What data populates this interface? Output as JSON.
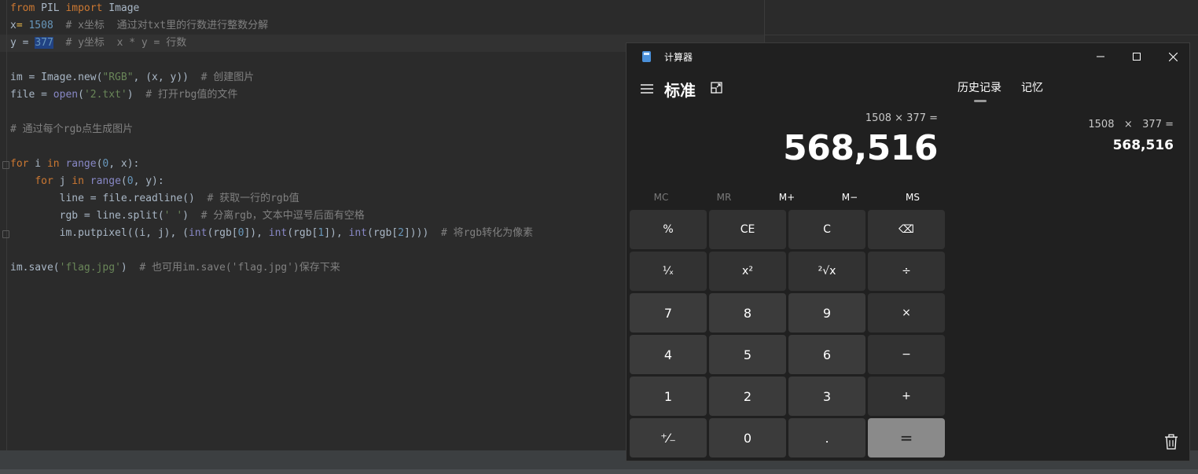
{
  "editor": {
    "lines": [
      [
        {
          "t": "from",
          "c": "kw"
        },
        {
          "t": " PIL "
        },
        {
          "t": "import",
          "c": "kw"
        },
        {
          "t": " Image"
        }
      ],
      [
        {
          "t": "x"
        },
        {
          "t": "= ",
          "c": "bulb"
        },
        {
          "t": "1508",
          "c": "num"
        },
        {
          "t": "  "
        },
        {
          "t": "# x坐标  通过对txt里的行数进行整数分解",
          "c": "cmt"
        }
      ],
      [
        {
          "t": "y = "
        },
        {
          "t": "377",
          "c": "num sel"
        },
        {
          "t": "  "
        },
        {
          "t": "# y坐标  x * y = 行数",
          "c": "cmt"
        }
      ],
      [],
      [
        {
          "t": "im = Image.new("
        },
        {
          "t": "\"RGB\"",
          "c": "str"
        },
        {
          "t": ", (x, y))  "
        },
        {
          "t": "# 创建图片",
          "c": "cmt"
        }
      ],
      [
        {
          "t": "file = "
        },
        {
          "t": "open",
          "c": "bi"
        },
        {
          "t": "("
        },
        {
          "t": "'2.txt'",
          "c": "str"
        },
        {
          "t": ")  "
        },
        {
          "t": "# 打开rbg值的文件",
          "c": "cmt"
        }
      ],
      [],
      [
        {
          "t": "# 通过每个rgb点生成图片",
          "c": "cmt"
        }
      ],
      [],
      [
        {
          "t": "for",
          "c": "kw"
        },
        {
          "t": " i "
        },
        {
          "t": "in",
          "c": "kw"
        },
        {
          "t": " "
        },
        {
          "t": "range",
          "c": "bi"
        },
        {
          "t": "("
        },
        {
          "t": "0",
          "c": "num"
        },
        {
          "t": ", x):"
        }
      ],
      [
        {
          "t": "    "
        },
        {
          "t": "for",
          "c": "kw"
        },
        {
          "t": " j "
        },
        {
          "t": "in",
          "c": "kw"
        },
        {
          "t": " "
        },
        {
          "t": "range",
          "c": "bi"
        },
        {
          "t": "("
        },
        {
          "t": "0",
          "c": "num"
        },
        {
          "t": ", y):"
        }
      ],
      [
        {
          "t": "        line = file.readline()  "
        },
        {
          "t": "# 获取一行的rgb值",
          "c": "cmt"
        }
      ],
      [
        {
          "t": "        rgb = line.split("
        },
        {
          "t": "' '",
          "c": "str"
        },
        {
          "t": ")  "
        },
        {
          "t": "# 分离rgb，文本中逗号后面有空格",
          "c": "cmt"
        }
      ],
      [
        {
          "t": "        im.putpixel((i, j), ("
        },
        {
          "t": "int",
          "c": "bi"
        },
        {
          "t": "(rgb["
        },
        {
          "t": "0",
          "c": "num"
        },
        {
          "t": "]), "
        },
        {
          "t": "int",
          "c": "bi"
        },
        {
          "t": "(rgb["
        },
        {
          "t": "1",
          "c": "num"
        },
        {
          "t": "]), "
        },
        {
          "t": "int",
          "c": "bi"
        },
        {
          "t": "(rgb["
        },
        {
          "t": "2",
          "c": "num"
        },
        {
          "t": "])))  "
        },
        {
          "t": "# 将rgb转化为像素",
          "c": "cmt"
        }
      ],
      [],
      [
        {
          "t": "im.save("
        },
        {
          "t": "'flag.jpg'",
          "c": "str"
        },
        {
          "t": ")  "
        },
        {
          "t": "# 也可用im.save('flag.jpg')保存下来",
          "c": "cmt"
        }
      ]
    ]
  },
  "calculator": {
    "title": "计算器",
    "mode": "标准",
    "tabs": {
      "history": "历史记录",
      "memory": "记忆"
    },
    "expression": "1508 × 377 =",
    "result": "568,516",
    "memory_buttons": [
      "MC",
      "MR",
      "M+",
      "M−",
      "MS"
    ],
    "keys": [
      [
        "%",
        "CE",
        "C",
        "⌫"
      ],
      [
        "¹⁄ₓ",
        "x²",
        "²√x",
        "÷"
      ],
      [
        "7",
        "8",
        "9",
        "×"
      ],
      [
        "4",
        "5",
        "6",
        "−"
      ],
      [
        "1",
        "2",
        "3",
        "+"
      ],
      [
        "⁺⁄₋",
        "0",
        ".",
        "="
      ]
    ],
    "history": {
      "expression": "1508   ×   377 =",
      "result": "568,516"
    },
    "window_buttons": {
      "minimize": "—",
      "maximize": "☐",
      "close": "✕"
    }
  }
}
